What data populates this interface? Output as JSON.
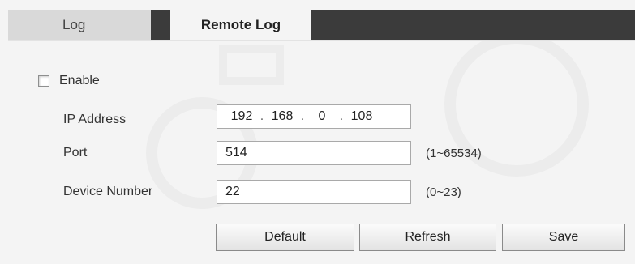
{
  "tabs": [
    {
      "label": "Log",
      "active": false
    },
    {
      "label": "Remote Log",
      "active": true
    }
  ],
  "form": {
    "enable": {
      "label": "Enable",
      "checked": false
    },
    "ip_address": {
      "label": "IP Address",
      "octets": [
        "192",
        "168",
        "0",
        "108"
      ]
    },
    "port": {
      "label": "Port",
      "value": "514",
      "hint": "(1~65534)"
    },
    "device_number": {
      "label": "Device Number",
      "value": "22",
      "hint": "(0~23)"
    }
  },
  "buttons": {
    "default": "Default",
    "refresh": "Refresh",
    "save": "Save"
  },
  "colors": {
    "tabbar_dark": "#3b3b3b",
    "inactive_tab": "#d9d9d9",
    "background": "#f4f4f4"
  }
}
